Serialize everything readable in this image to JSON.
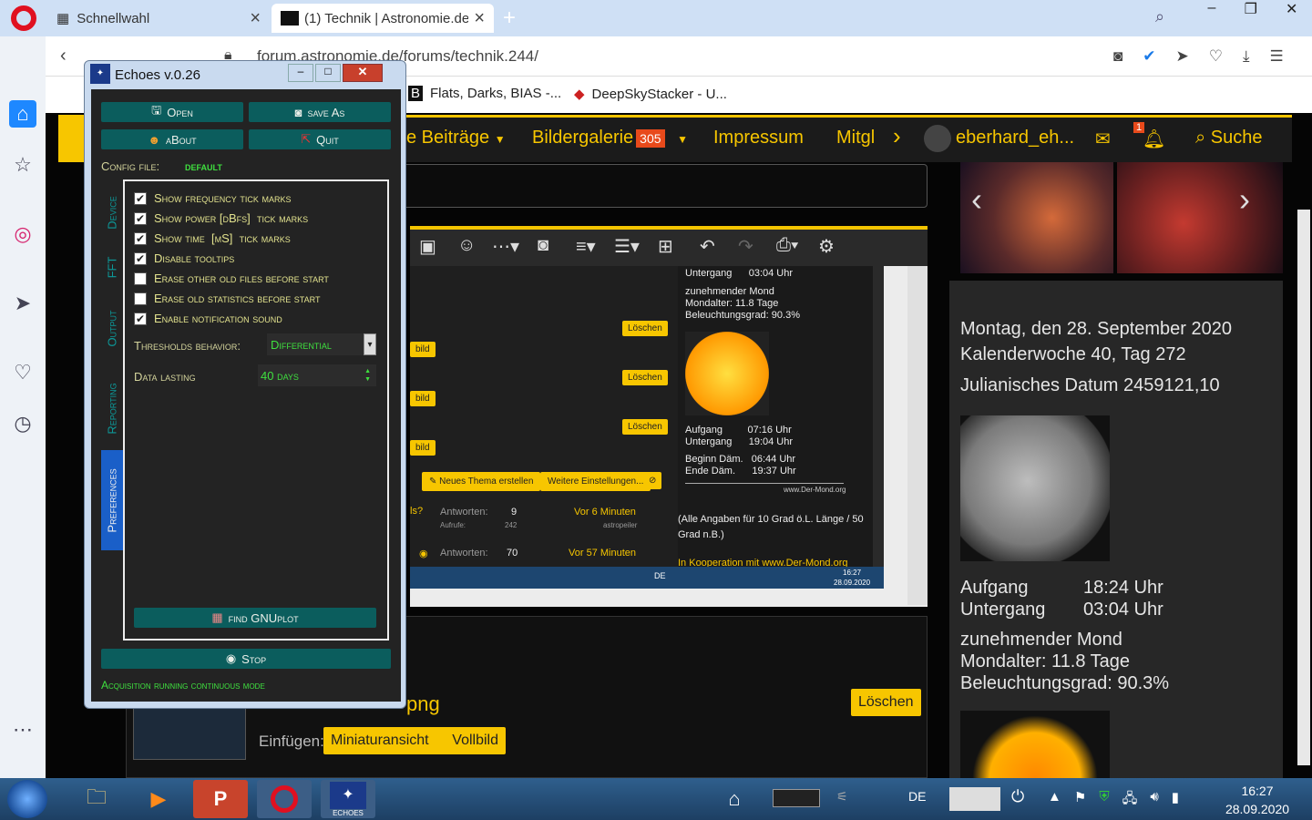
{
  "browser": {
    "tabs": [
      {
        "label": "Schnellwahl"
      },
      {
        "label": "(1) Technik | Astronomie.de"
      }
    ],
    "url": "forum.astronomie.de/forums/technik.244/",
    "bookmarks": [
      "Flats, Darks, BIAS -...",
      "DeepSkyStacker - U..."
    ]
  },
  "forum": {
    "nav": {
      "beitraege": "e Beiträge",
      "galerie": "Bildergalerie",
      "galerie_count": "305",
      "impressum": "Impressum",
      "mitglieder": "Mitgl",
      "user": "eberhard_eh...",
      "notif_count": "1",
      "search": "Suche"
    },
    "right": {
      "date": "Montag, den 28. September 2020",
      "week": "Kalenderwoche 40, Tag 272",
      "julian": "Julianisches Datum 2459121,10",
      "rise_label": "Aufgang",
      "rise_time": "18:24 Uhr",
      "set_label": "Untergang",
      "set_time": "03:04 Uhr",
      "phase": "zunehmender Mond",
      "age": "Mondalter: 11.8 Tage",
      "illum": "Beleuchtungsgrad: 90.3%"
    },
    "attachment": {
      "name": "png",
      "delete": "Löschen",
      "insert_label": "Einfügen:",
      "thumb": "Miniaturansicht",
      "full": "Vollbild"
    },
    "inner": {
      "set_top": "Untergang      03:04 Uhr",
      "phase": "zunehmender Mond",
      "age": "Mondalter: 11.8 Tage",
      "illum": "Beleuchtungsgrad: 90.3%",
      "sun_rise": "Aufgang         07:16 Uhr",
      "sun_set": "Untergang      19:04 Uhr",
      "dawn_begin": "Beginn Däm.   06:44 Uhr",
      "dawn_end": "Ende Däm.      19:37 Uhr",
      "source": "www.Der-Mond.org",
      "note": "(Alle Angaben für 10 Grad ö.L. Länge / 50 Grad n.B.)",
      "coop": "In Kooperation mit www.Der-Mond.org",
      "delete": "Löschen",
      "bild": "bild",
      "new_thread": "Neues Thema erstellen",
      "more_settings": "Weitere Einstellungen...",
      "answers": "Antworten:",
      "views": "Aufrufe:",
      "row1_answers": "9",
      "row1_views": "242",
      "row1_time": "Vor 6 Minuten",
      "row1_user": "astropeiler",
      "row2_answers": "70",
      "row2_time": "Vor 57 Minuten",
      "ls": "ls?",
      "tb_lang": "DE",
      "tb_time": "16:27",
      "tb_date": "28.09.2020"
    }
  },
  "echoes": {
    "title": "Echoes v.0.26",
    "buttons": {
      "open": "Open",
      "save_as": "save As",
      "about": "aBout",
      "quit": "Quit",
      "find_gnuplot": "find GNUplot",
      "stop": "Stop"
    },
    "config_label": "Config file:",
    "config_value": "default",
    "tabs": [
      "Device",
      "FFT",
      "Output",
      "Reporting",
      "Preferences"
    ],
    "checkboxes": [
      {
        "label": "Show frequency tick marks",
        "checked": true
      },
      {
        "label": "Show power [dBfs]  tick marks",
        "checked": true
      },
      {
        "label": "Show time  [mS]  tick marks",
        "checked": true
      },
      {
        "label": "Disable tooltips",
        "checked": true
      },
      {
        "label": "Erase other old files before start",
        "checked": false
      },
      {
        "label": "Erase old statistics before start",
        "checked": false
      },
      {
        "label": "Enable notification sound",
        "checked": true
      }
    ],
    "thresholds_label": "Thresholds behavior:",
    "thresholds_value": "Differential",
    "data_lasting_label": "Data lasting",
    "data_lasting_value": "40 days",
    "status": "Acquisition running continuous mode"
  },
  "taskbar": {
    "lang": "DE",
    "time": "16:27",
    "date": "28.09.2020",
    "echoes_label": "ECHOES"
  }
}
